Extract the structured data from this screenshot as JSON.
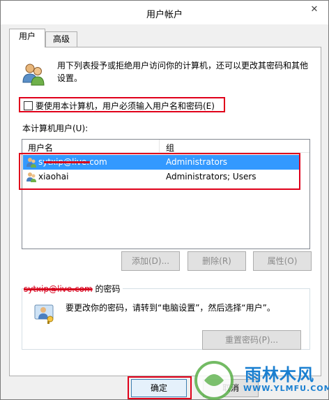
{
  "window": {
    "title": "用户帐户",
    "close_glyph": "✕"
  },
  "tabs": [
    {
      "label": "用户",
      "active": true
    },
    {
      "label": "高级",
      "active": false
    }
  ],
  "intro": {
    "icon": "users-icon",
    "text": "用下列表授予或拒绝用户访问你的计算机，还可以更改其密码和其他设置。"
  },
  "require_login": {
    "checked": false,
    "label": "要使用本计算机，用户必须输入用户名和密码(E)"
  },
  "users_section": {
    "label": "本计算机用户(U):",
    "columns": {
      "name": "用户名",
      "group": "组"
    },
    "rows": [
      {
        "name": "sytxip@live.com",
        "group": "Administrators",
        "selected": true,
        "icon": "user-account-icon"
      },
      {
        "name": "xiaohai",
        "group": "Administrators; Users",
        "selected": false,
        "icon": "user-account-icon"
      }
    ],
    "buttons": {
      "add": "添加(D)...",
      "remove": "删除(R)",
      "properties": "属性(O)"
    }
  },
  "password_section": {
    "legend_user": "sytxip@live.com",
    "legend_suffix": "的密码",
    "icon": "user-key-icon",
    "text": "要更改你的密码，请转到“电脑设置”，然后选择“用户”。",
    "reset_button": "重置密码(P)..."
  },
  "footer": {
    "ok": "确定",
    "cancel": "取消"
  },
  "watermark": {
    "name": "雨林木风",
    "site": "WWW.YLMFU.COM"
  },
  "colors": {
    "selection": "#3399ff",
    "annotation_red": "#e0001a",
    "watermark_blue": "#1a7fd0"
  }
}
